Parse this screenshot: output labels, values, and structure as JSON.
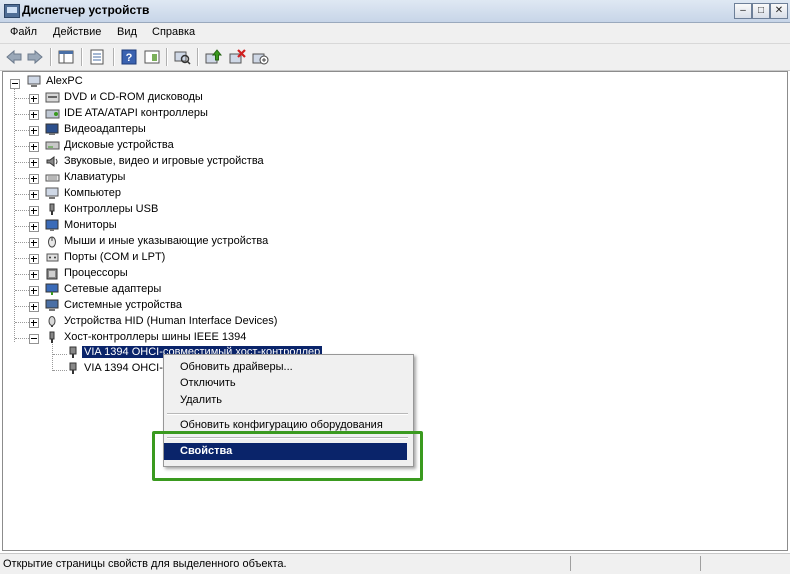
{
  "window": {
    "title": "Диспетчер устройств",
    "minimize": "–",
    "maximize": "□",
    "close": "✕"
  },
  "menu": [
    "Файл",
    "Действие",
    "Вид",
    "Справка"
  ],
  "tree": {
    "root": "AlexPC",
    "categories": [
      "DVD и CD-ROM дисководы",
      "IDE ATA/ATAPI контроллеры",
      "Видеоадаптеры",
      "Дисковые устройства",
      "Звуковые, видео и игровые устройства",
      "Клавиатуры",
      "Компьютер",
      "Контроллеры USB",
      "Мониторы",
      "Мыши и иные указывающие устройства",
      "Порты (COM и LPT)",
      "Процессоры",
      "Сетевые адаптеры",
      "Системные устройства",
      "Устройства HID (Human Interface Devices)",
      "Хост-контроллеры шины IEEE 1394"
    ],
    "children": [
      "VIA 1394 OHCI-совместимый хост-контроллер",
      "VIA 1394 OHCI-"
    ]
  },
  "context_menu": {
    "update_drivers": "Обновить драйверы...",
    "disable": "Отключить",
    "delete": "Удалить",
    "scan": "Обновить конфигурацию оборудования",
    "properties": "Свойства"
  },
  "status": {
    "text": "Открытие страницы свойств для выделенного объекта."
  },
  "colors": {
    "selection": "#0a246a",
    "annotation": "#3a9a1f"
  }
}
